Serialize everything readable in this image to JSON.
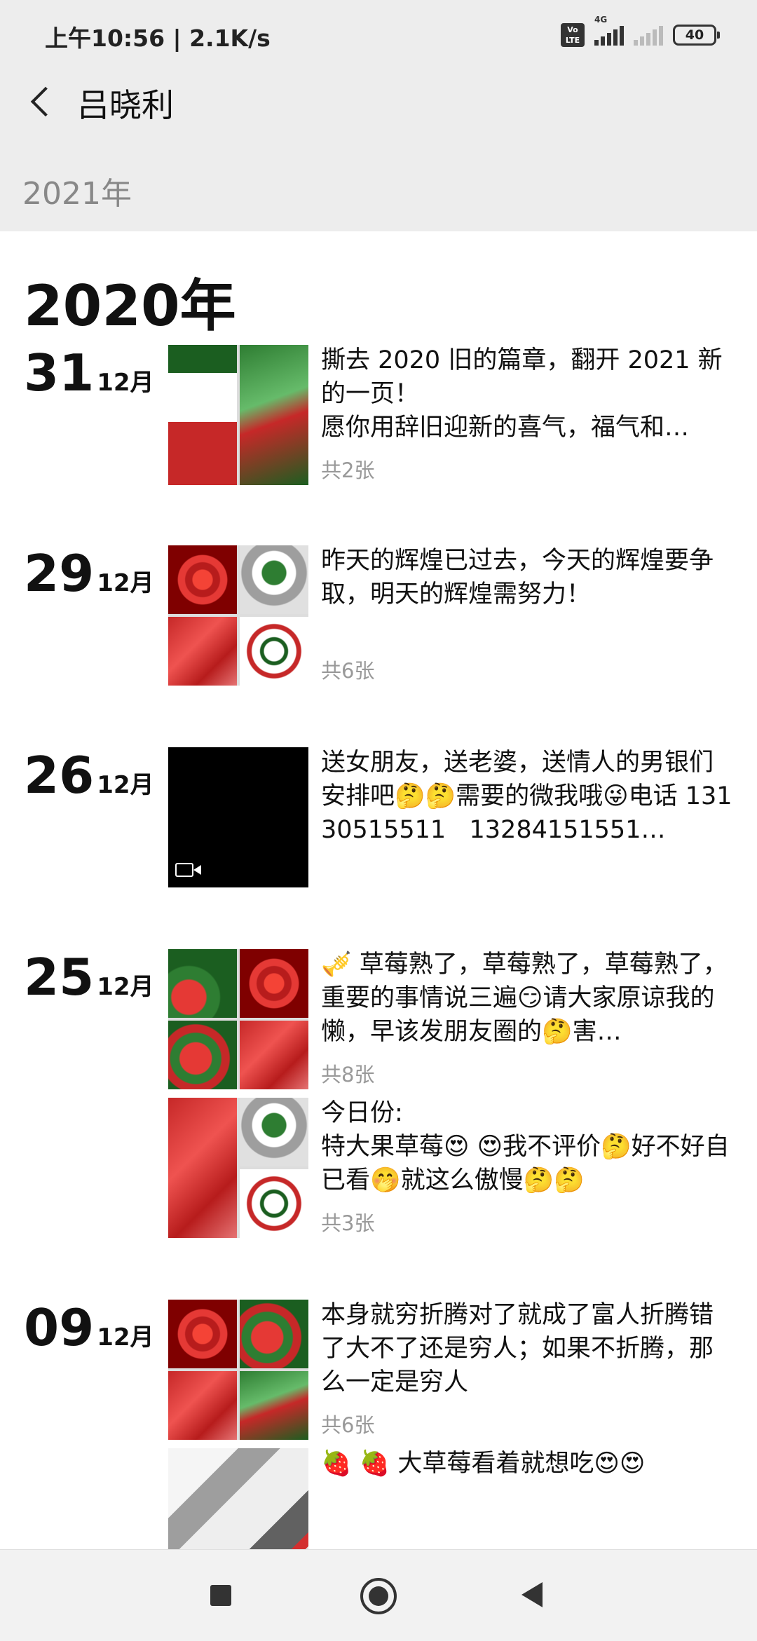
{
  "status_bar": {
    "time": "上午10:56 | 2.1K/s",
    "volte_top": "Vo",
    "volte_bottom": "LTE",
    "network": "4G",
    "battery": "40"
  },
  "nav": {
    "title": "吕晓利"
  },
  "year_header": "2021年",
  "year_section": "2020年",
  "entries": [
    {
      "day": "31",
      "month": "12月",
      "text": "撕去 2020 旧的篇章，翻开 2021 新的一页！\n愿你用辞旧迎新的喜气，福气和…",
      "count": "共2张"
    },
    {
      "day": "29",
      "month": "12月",
      "text": "昨天的辉煌已过去，今天的辉煌要争取，明天的辉煌需努力！",
      "count": "共6张"
    },
    {
      "day": "26",
      "month": "12月",
      "text": "送女朋友，送老婆，送情人的男银们安排吧🤔🤔需要的微我哦😜电话 13130515511   13284151551…",
      "count": ""
    },
    {
      "day": "25",
      "month": "12月",
      "text": "🎺 草莓熟了，草莓熟了，草莓熟了，重要的事情说三遍😏请大家原谅我的懒，早该发朋友圈的🤔害…",
      "count": "共8张",
      "text2": "今日份:\n特大果草莓😍 😍我不评价🤔好不好自已看🤭就这么傲慢🤔🤔",
      "count2": "共3张"
    },
    {
      "day": "09",
      "month": "12月",
      "text": "本身就穷折腾对了就成了富人折腾错了大不了还是穷人；如果不折腾，那么一定是穷人",
      "count": "共6张",
      "text2": "🍓 🍓 大草莓看着就想吃😍😍",
      "count2": ""
    }
  ],
  "icons": {
    "back": "back-arrow-icon",
    "video": "video-camera-icon",
    "nav_square": "recent-apps-icon",
    "nav_home": "home-circle-icon",
    "nav_back": "back-triangle-icon"
  }
}
